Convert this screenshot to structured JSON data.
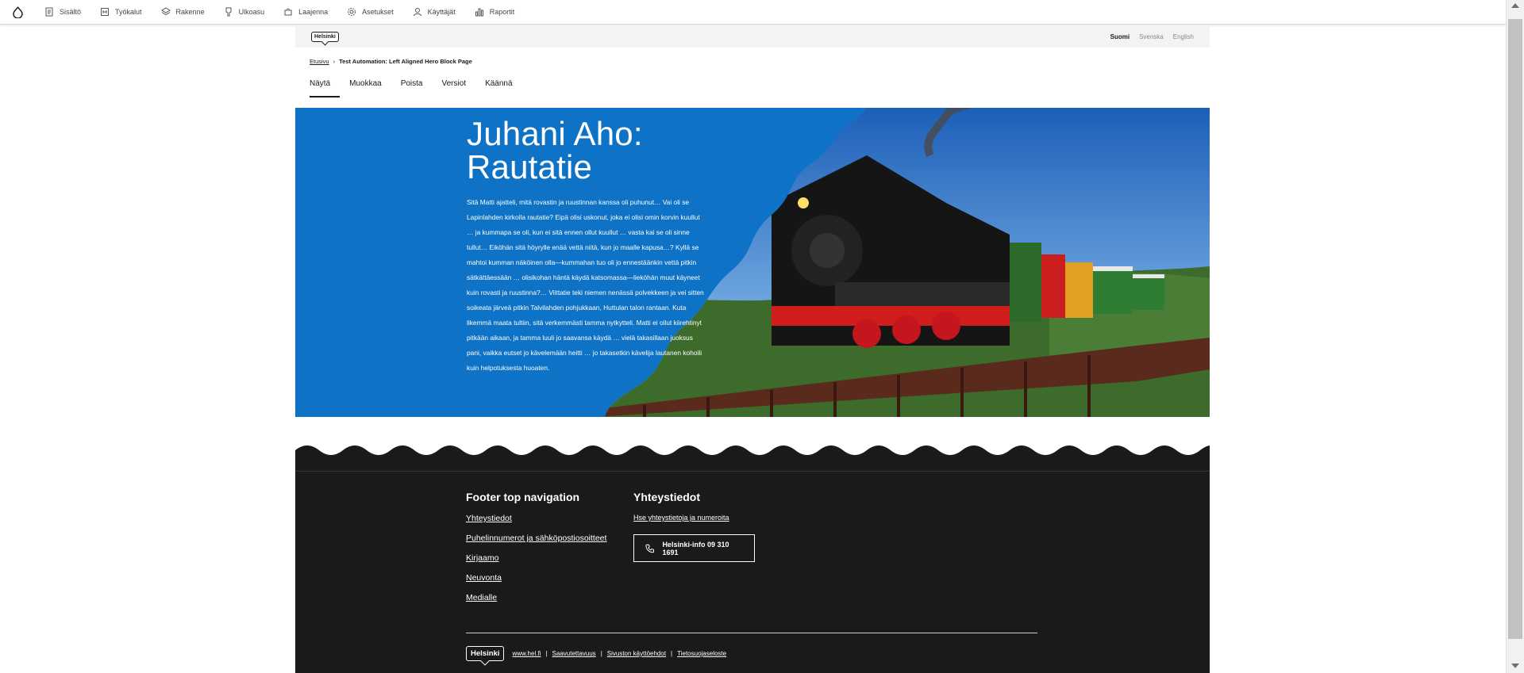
{
  "toolbar": {
    "items": [
      {
        "label": "Sisältö",
        "icon": "file-icon"
      },
      {
        "label": "Työkalut",
        "icon": "tools-icon"
      },
      {
        "label": "Rakenne",
        "icon": "layers-icon"
      },
      {
        "label": "Ulkoasu",
        "icon": "paint-icon"
      },
      {
        "label": "Laajenna",
        "icon": "puzzle-icon"
      },
      {
        "label": "Asetukset",
        "icon": "gear-icon"
      },
      {
        "label": "Käyttäjät",
        "icon": "user-icon"
      },
      {
        "label": "Raportit",
        "icon": "chart-icon"
      }
    ]
  },
  "header": {
    "logo": "Helsinki",
    "languages": [
      "Suomi",
      "Svenska",
      "English"
    ],
    "active_language": "Suomi"
  },
  "breadcrumb": {
    "home": "Etusivu",
    "current": "Test Automation: Left Aligned Hero Block Page"
  },
  "tabs": [
    "Näytä",
    "Muokkaa",
    "Poista",
    "Versiot",
    "Käännä"
  ],
  "hero": {
    "title_line1": "Juhani Aho:",
    "title_line2": "Rautatie",
    "text": "Sitä Matti ajatteli, mitä rovastin ja ruustinnan kanssa oli puhunut… Vai oli se Lapinlahden kirkolla rautatie? Eipä olisi uskonut, joka ei olisi omin korvin kuullut … ja kummapa se oli, kun ei sitä ennen ollut kuullut … vasta kai se oli sinne tullut… Eiköhän sitä höyrylle enää vettä niitä, kun jo maalle kapusa…? Kyllä se mahtoi kumman näköinen olla—kummahan tuo oli jo ennestäänkin vettä pitkin sätkättäessään … olisikohan häntä käydä katsomassa—liekö­hän muut käyneet kuin rovasti ja ruustinna?… Viittatie teki niemen nenässä polvekkeen ja vei sitten soikeata järveä pitkin Talvilahden pohjukkaan, Huttulan talon rantaan. Kuta likemmä maata tultiin, sitä verkemmästi tamma nytkytteli. Matti ei ollut kiirehtinyt pitkään aikaan, ja tamma luuli jo saavansa käydä … vielä takasillaan juoksus pani, vaikka eutset jo kävelemään heitti … jo takasetkin kävelija lautanen kohoili kuin helpotuksesta huoaten.",
    "colors": {
      "background": "#0e72c6"
    }
  },
  "footer": {
    "nav_title": "Footer top navigation",
    "nav_links": [
      "Yhteystiedot",
      "Puhelinnumerot ja sähköpostiosoitteet",
      "Kirjaamo",
      "Neuvonta",
      "Medialle"
    ],
    "contact_title": "Yhteystiedot",
    "contact_link": "Hse yhteystietoja ja numeroita",
    "phone_label": "Helsinki-info 09 310 1691",
    "logo": "Helsinki",
    "bottom_links": [
      "www.hel.fi",
      "Saavutettavuus",
      "Sivuston käyttöehdot",
      "Tietosuojaseloste"
    ],
    "colors": {
      "background": "#1a1a1a"
    }
  }
}
